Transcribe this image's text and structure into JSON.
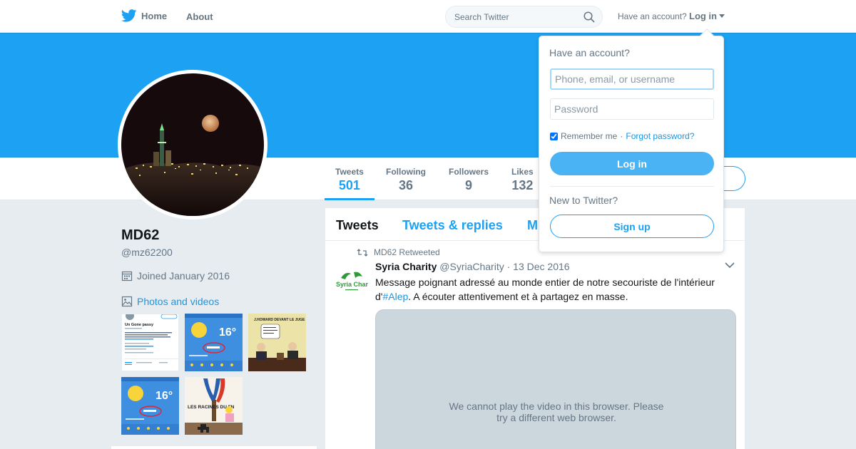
{
  "nav": {
    "home_label": "Home",
    "about_label": "About",
    "search_placeholder": "Search Twitter",
    "have_account": "Have an account?",
    "login_label": "Log in"
  },
  "colors": {
    "brand": "#1da1f2",
    "banner": "#1da1f2",
    "link": "#1b95e0"
  },
  "profile": {
    "name": "MD62",
    "handle": "@mz62200",
    "joined": "Joined January 2016",
    "photos_label": "Photos and videos"
  },
  "stats": [
    {
      "label": "Tweets",
      "value": "501",
      "active": true
    },
    {
      "label": "Following",
      "value": "36"
    },
    {
      "label": "Followers",
      "value": "9"
    },
    {
      "label": "Likes",
      "value": "132"
    }
  ],
  "thumbs": [
    {
      "title": "Un Gone passy",
      "kind": "profile-screenshot"
    },
    {
      "temp": "16°",
      "kind": "weather"
    },
    {
      "kind": "cartoon",
      "caption": "J.HOWARD DEVANT LE JUGE"
    },
    {
      "temp": "16°",
      "kind": "weather"
    },
    {
      "kind": "cartoon",
      "caption": "LES RACINES DU FN"
    }
  ],
  "timeline": {
    "tabs": [
      "Tweets",
      "Tweets & replies",
      "M"
    ],
    "tweet": {
      "retweet_line": "MD62 Retweeted",
      "name": "Syria Charity",
      "handle": "@SyriaCharity",
      "dot": "·",
      "date": "13 Dec 2016",
      "text_before": "Message poignant adressé au monde entier de notre secouriste de l'intérieur d'",
      "hashtag": "#Alep",
      "text_after": ". A écouter attentivement et à partagez en masse.",
      "avatar_brand": "Syria Charity",
      "video_message": "We cannot play the video in this browser. Please try a different web browser."
    }
  },
  "login_dropdown": {
    "title": "Have an account?",
    "username_placeholder": "Phone, email, or username",
    "password_placeholder": "Password",
    "remember_label": "Remember me",
    "separator": "·",
    "forgot_label": "Forgot password?",
    "login_button": "Log in",
    "new_label": "New to Twitter?",
    "signup_button": "Sign up",
    "remember_checked": true
  }
}
